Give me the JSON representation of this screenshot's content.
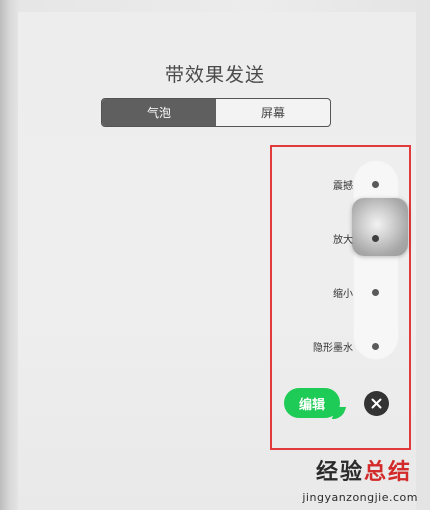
{
  "dialog": {
    "title": "带效果发送",
    "tabs": [
      {
        "label": "气泡",
        "active": true
      },
      {
        "label": "屏幕",
        "active": false
      }
    ]
  },
  "effects": [
    {
      "label": "震撼"
    },
    {
      "label": "放大",
      "selected": true
    },
    {
      "label": "缩小"
    },
    {
      "label": "隐形墨水"
    }
  ],
  "message": {
    "bubble_text": "编辑"
  },
  "colors": {
    "bubble": "#1fcb57",
    "highlight": "#e23a3a",
    "accent": "#d32a2a"
  },
  "icons": {
    "cancel": "close-icon"
  },
  "watermark": {
    "text_dark": "经验",
    "text_accent": "总结",
    "url": "jingyanzongjie.com"
  }
}
